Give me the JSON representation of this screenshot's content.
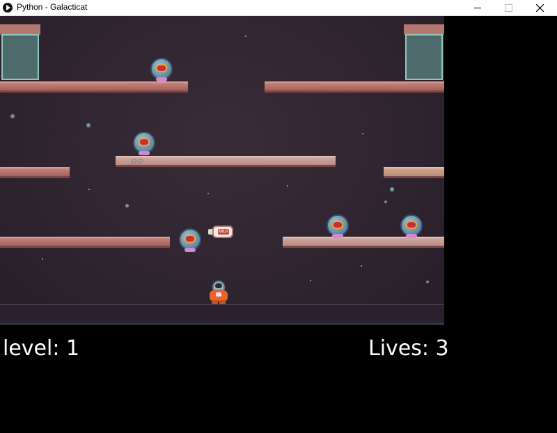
{
  "window": {
    "title": "Python - Galacticat",
    "icon": "python-launcher-icon",
    "controls": {
      "minimize": "minimize-icon",
      "maximize": "maximize-icon",
      "close": "close-icon"
    }
  },
  "hud": {
    "level_text": "level: 1",
    "lives_text": "Lives: 3"
  },
  "scene": {
    "platform_labels": [
      "RP"
    ],
    "pickup_label": "MILK"
  },
  "colors": {
    "space": "#2e2430",
    "platform": "#b57870",
    "player_suit": "#e8642a",
    "ground_edge": "#6b8f8f"
  }
}
